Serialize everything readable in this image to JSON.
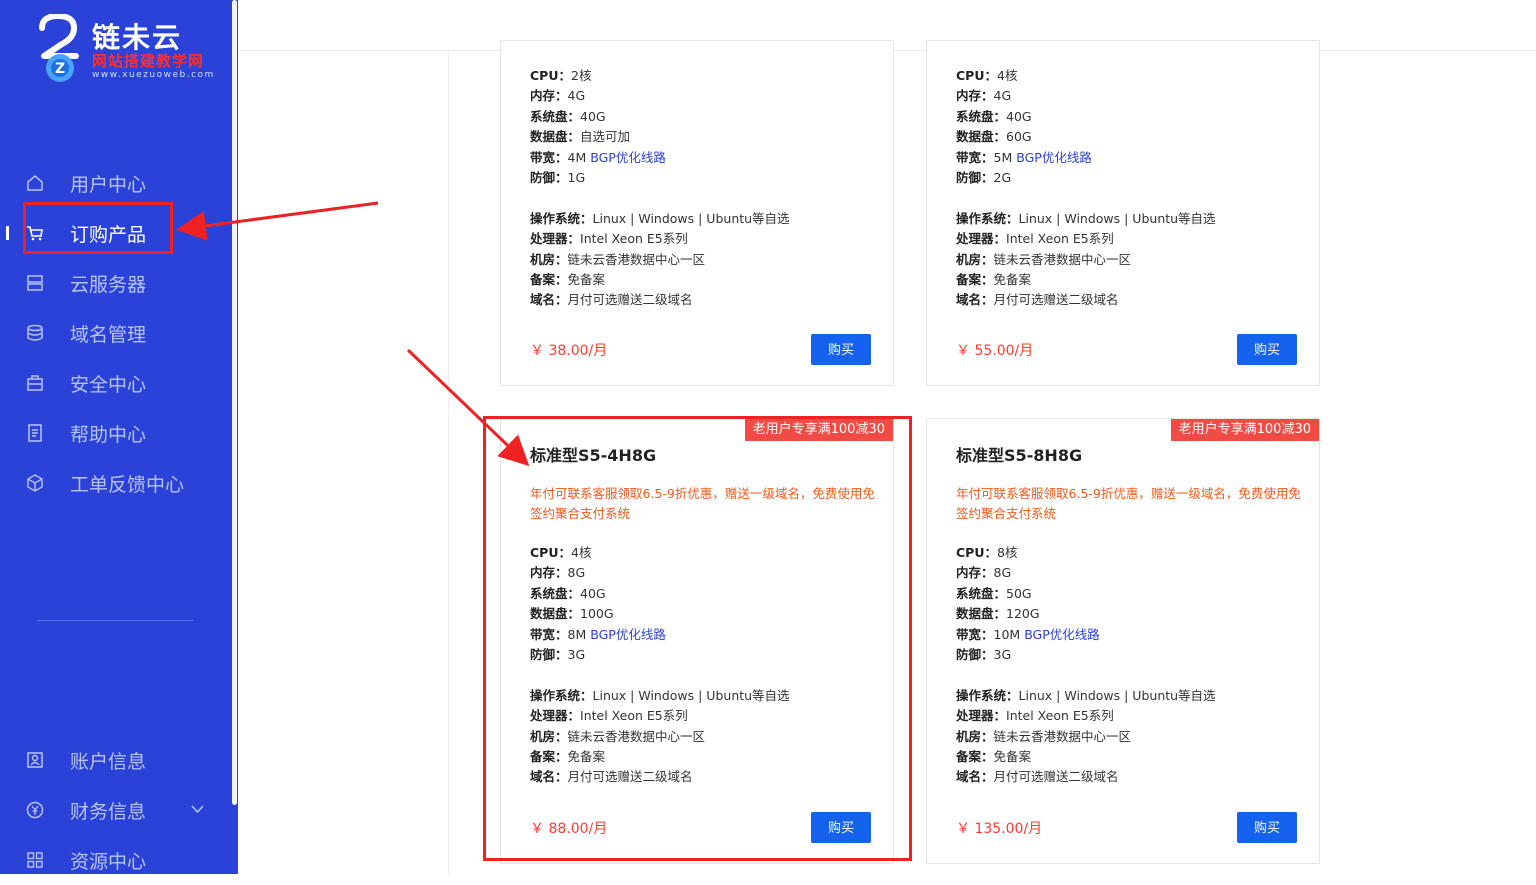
{
  "brand": {
    "title": "链未云",
    "subtitle": "网站搭建教学网",
    "url": "www.xuezuoweb.com"
  },
  "sidebar": {
    "items": [
      {
        "label": "用户中心",
        "icon": "home-icon"
      },
      {
        "label": "订购产品",
        "icon": "cart-icon",
        "active": true
      },
      {
        "label": "云服务器",
        "icon": "server-icon"
      },
      {
        "label": "域名管理",
        "icon": "database-icon"
      },
      {
        "label": "安全中心",
        "icon": "briefcase-icon"
      },
      {
        "label": "帮助中心",
        "icon": "document-icon"
      },
      {
        "label": "工单反馈中心",
        "icon": "cube-icon"
      }
    ],
    "bottom_items": [
      {
        "label": "账户信息",
        "icon": "user-card-icon"
      },
      {
        "label": "财务信息",
        "icon": "yuan-icon",
        "expandable": true
      },
      {
        "label": "资源中心",
        "icon": "grid-icon"
      }
    ]
  },
  "labels": {
    "cpu": "CPU：",
    "mem": "内存：",
    "sys_disk": "系统盘：",
    "data_disk": "数据盘：",
    "bandwidth": "带宽：",
    "defense": "防御：",
    "os": "操作系统：",
    "cpu_model": "处理器：",
    "datacenter": "机房：",
    "icp": "备案：",
    "domain": "域名：",
    "bgp": "BGP优化线路",
    "buy": "购买"
  },
  "common": {
    "os": "Linux | Windows | Ubuntu等自选",
    "cpu_model": "Intel Xeon E5系列",
    "datacenter": "链未云香港数据中心一区",
    "icp": "免备案",
    "domain": "月付可选赠送二级域名",
    "promo": "年付可联系客服领取6.5-9折优惠，赠送一级域名，免费使用免签约聚合支付系统",
    "badge": "老用户专享满100减30"
  },
  "cards": [
    {
      "cpu": "2核",
      "mem": "4G",
      "sys_disk": "40G",
      "data_disk": "自选可加",
      "bandwidth": "4M",
      "defense": "1G",
      "price": "￥ 38.00/月"
    },
    {
      "cpu": "4核",
      "mem": "4G",
      "sys_disk": "40G",
      "data_disk": "60G",
      "bandwidth": "5M",
      "defense": "2G",
      "price": "￥ 55.00/月"
    },
    {
      "title": "标准型S5-4H8G",
      "cpu": "4核",
      "mem": "8G",
      "sys_disk": "40G",
      "data_disk": "100G",
      "bandwidth": "8M",
      "defense": "3G",
      "price": "￥ 88.00/月"
    },
    {
      "title": "标准型S5-8H8G",
      "cpu": "8核",
      "mem": "8G",
      "sys_disk": "50G",
      "data_disk": "120G",
      "bandwidth": "10M",
      "defense": "3G",
      "price": "￥ 135.00/月"
    }
  ],
  "colors": {
    "sidebar_bg": "#2a42d8",
    "accent_button": "#1462ee",
    "price": "#ff3b30",
    "promo": "#f05a1a",
    "badge": "#f04b45",
    "annotation": "#ee2222"
  }
}
